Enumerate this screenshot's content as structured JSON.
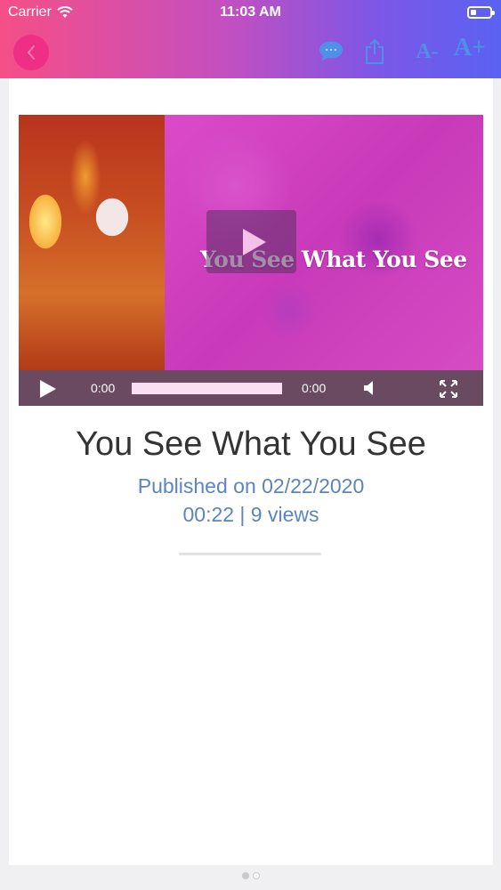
{
  "status_bar": {
    "carrier": "Carrier",
    "time": "11:03 AM",
    "battery_level": 0.3
  },
  "toolbar": {
    "back_icon": "chevron-left-icon",
    "comment_icon": "comment-icon",
    "share_icon": "share-icon",
    "font_decrease_label": "A-",
    "font_increase_label": "A+",
    "accent_color": "#4f90ea",
    "back_button_color": "#ee2f85",
    "gradient": [
      "#f54f86",
      "#c44fc0",
      "#7d57e6",
      "#5a62f2"
    ]
  },
  "video": {
    "thumbnail_text": "You See What You See",
    "current_time": "0:00",
    "total_time": "0:00",
    "progress": 0,
    "play_icon": "play-icon",
    "volume_icon": "volume-icon",
    "fullscreen_icon": "fullscreen-icon"
  },
  "article": {
    "title": "You See What You See",
    "published": "Published on 02/22/2020",
    "meta": "00:22 | 9 views",
    "meta_color": "#5b84c2"
  },
  "pager": {
    "total": 2,
    "active": 1
  }
}
